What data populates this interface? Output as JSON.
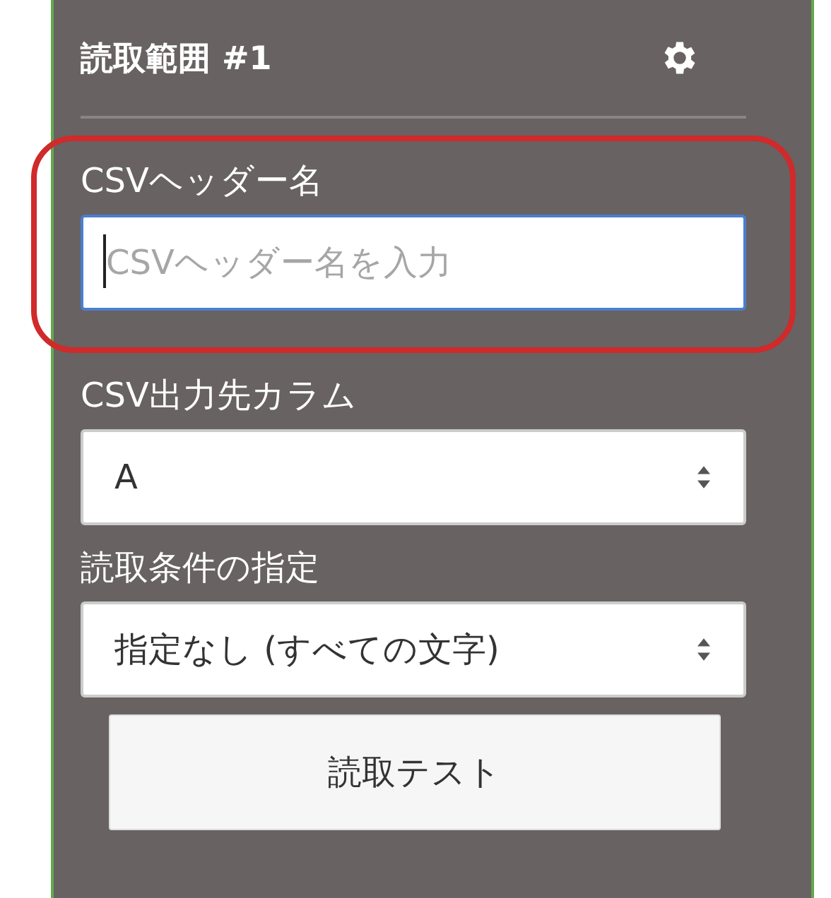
{
  "panel": {
    "title": "読取範囲 #1"
  },
  "fields": [
    {
      "kind": "text",
      "label": "CSVヘッダー名",
      "placeholder": "CSVヘッダー名を入力",
      "highlighted": true,
      "focused": true
    },
    {
      "kind": "select",
      "label": "CSV出力先カラム",
      "value": "A",
      "highlighted": false,
      "focused": false
    },
    {
      "kind": "select",
      "label": "読取条件の指定",
      "value": "指定なし (すべての文字)",
      "highlighted": false,
      "focused": false
    }
  ],
  "button": "読取テスト"
}
